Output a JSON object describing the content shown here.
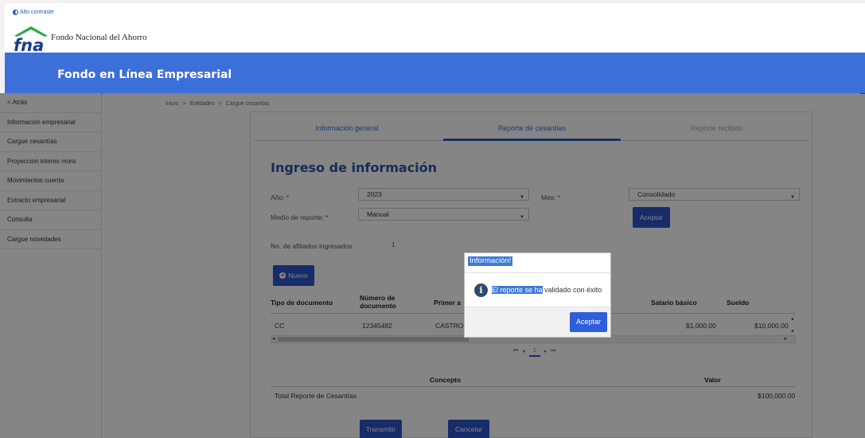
{
  "header": {
    "contrast_label": "Alto contraste",
    "logo_text": "fna",
    "brand_name": "Fondo Nacional del Ahorro",
    "banner_title": "Fondo en Línea Empresarial"
  },
  "sidebar": {
    "items": [
      {
        "label": "< Atrás"
      },
      {
        "label": "Informacion empresarial"
      },
      {
        "label": "Cargue cesantías"
      },
      {
        "label": "Proyeccion interes mora"
      },
      {
        "label": "Movimientos cuenta"
      },
      {
        "label": "Extracto empresarial"
      },
      {
        "label": "Consulta"
      },
      {
        "label": "Cargue novedades"
      }
    ]
  },
  "breadcrumb": {
    "items": [
      "Inicio",
      ">",
      "Entidades",
      ">",
      "Cargue cesantías"
    ]
  },
  "tabs": [
    {
      "label": "Información general"
    },
    {
      "label": "Reporte de cesantías"
    },
    {
      "label": "Reporte recibido"
    }
  ],
  "form": {
    "heading": "Ingreso de información",
    "year_label": "Año: *",
    "year_value": "2023",
    "month_label": "Mes: *",
    "month_value": "Consolidado",
    "medio_label": "Medio de reporte: *",
    "medio_value": "Manual",
    "accept_label": "Aceptar",
    "afiliados_label": "No. de afiliados ingresados",
    "afiliados_value": "1"
  },
  "table": {
    "new_label": "Nuevo",
    "columns": [
      "Tipo de documento",
      "Número de documento",
      "Primer a",
      "Salario básico",
      "Sueldo"
    ],
    "rows": [
      {
        "tipo": "CC",
        "numero": "12345482",
        "primer": "CASTRO",
        "salario": "$1,000.00",
        "sueldo": "$10,000.00"
      }
    ],
    "page": "1"
  },
  "summary": {
    "col_concepto": "Concepto",
    "col_valor": "Valor",
    "row_label": "Total Reporte de Cesantías",
    "row_value": "$100,000.00"
  },
  "actions": {
    "transmit": "Transmitir",
    "cancel": "Cancelar"
  },
  "modal": {
    "title": "Información!",
    "message_highlight": "El reporte se ha",
    "message_rest": " validado con éxito",
    "ok_label": "Aceptar"
  },
  "colors": {
    "brand_blue": "#3d6fd9",
    "button_blue": "#2d55c8",
    "highlight": "#3d7ad9"
  }
}
